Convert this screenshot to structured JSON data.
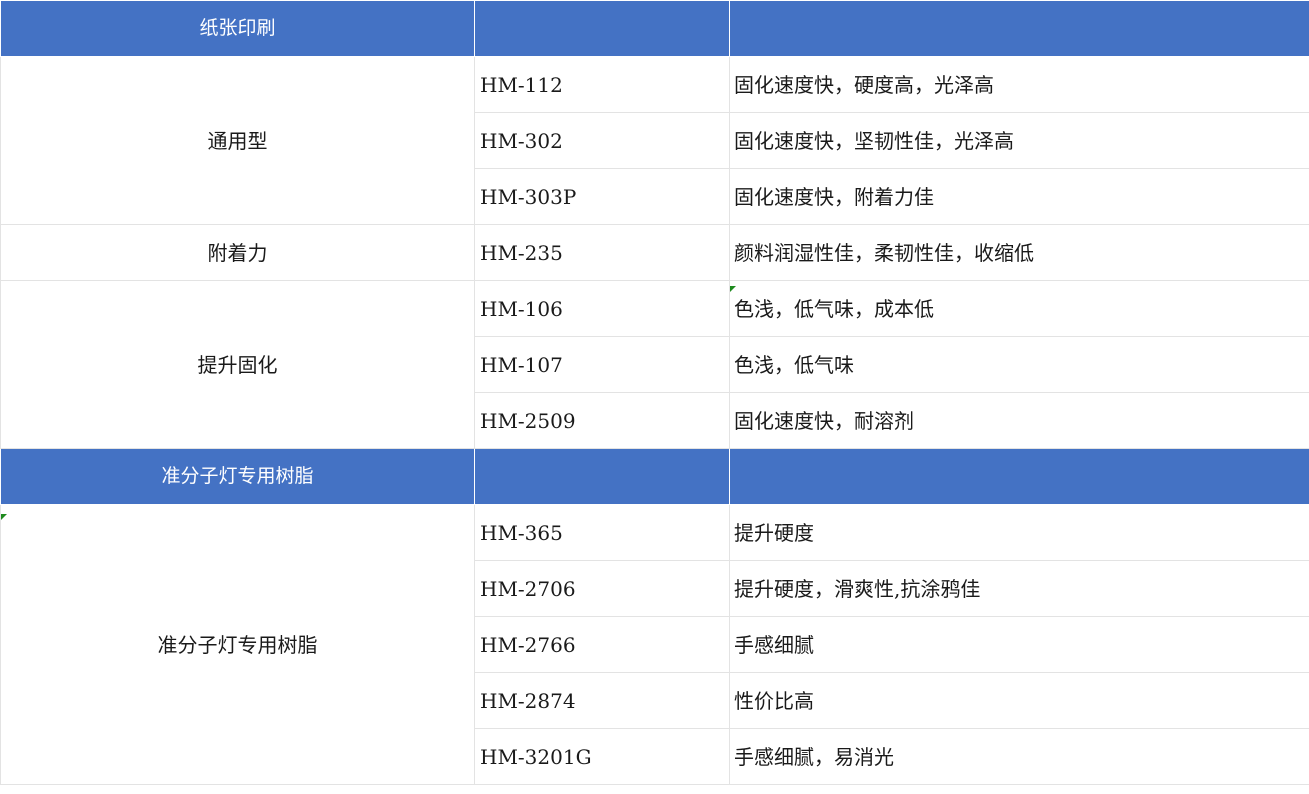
{
  "sections": [
    {
      "title": "纸张印刷",
      "groups": [
        {
          "category": "通用型",
          "rows": [
            {
              "code": "HM-112",
              "desc": "固化速度快，硬度高，光泽高"
            },
            {
              "code": "HM-302",
              "desc": "固化速度快，坚韧性佳，光泽高"
            },
            {
              "code": "HM-303P",
              "desc": "固化速度快，附着力佳"
            }
          ]
        },
        {
          "category": "附着力",
          "rows": [
            {
              "code": "HM-235",
              "desc": "颜料润湿性佳，柔韧性佳，收缩低"
            }
          ]
        },
        {
          "category": "提升固化",
          "rows": [
            {
              "code": "HM-106",
              "desc": "色浅，低气味，成本低"
            },
            {
              "code": "HM-107",
              "desc": "色浅，低气味"
            },
            {
              "code": "HM-2509",
              "desc": "固化速度快，耐溶剂"
            }
          ]
        }
      ]
    },
    {
      "title": "准分子灯专用树脂",
      "groups": [
        {
          "category": "准分子灯专用树脂",
          "rows": [
            {
              "code": "HM-365",
              "desc": "提升硬度"
            },
            {
              "code": "HM-2706",
              "desc": "提升硬度，滑爽性,抗涂鸦佳"
            },
            {
              "code": "HM-2766",
              "desc": "手感细腻"
            },
            {
              "code": "HM-2874",
              "desc": "性价比高"
            },
            {
              "code": "HM-3201G",
              "desc": "手感细腻，易消光"
            }
          ]
        }
      ]
    }
  ],
  "colors": {
    "header_bg": "#4472c4",
    "header_text": "#ffffff",
    "grid_line": "#e3e3e3",
    "comment_marker": "#1e8a1e"
  }
}
